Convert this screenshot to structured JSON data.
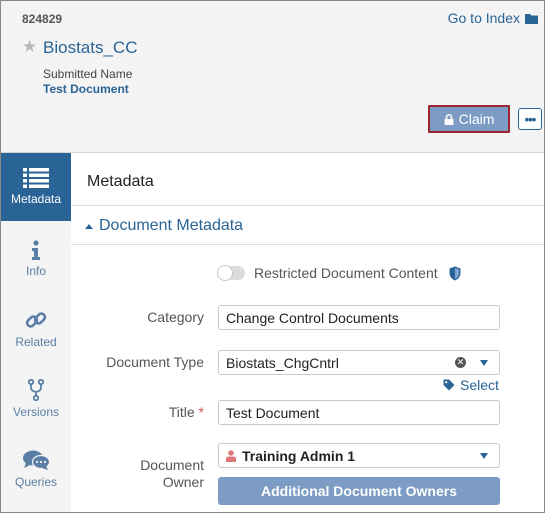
{
  "header": {
    "doc_number": "824829",
    "goto_index_label": "Go to Index",
    "doc_name": "Biostats_CC",
    "submitted_label": "Submitted Name",
    "submitted_value": "Test Document",
    "claim_label": "Claim",
    "more_label": "•••"
  },
  "sidebar": {
    "items": [
      {
        "label": "Metadata",
        "icon": "list-icon",
        "active": true
      },
      {
        "label": "Info",
        "icon": "info-icon",
        "active": false
      },
      {
        "label": "Related",
        "icon": "link-icon",
        "active": false
      },
      {
        "label": "Versions",
        "icon": "branch-icon",
        "active": false
      },
      {
        "label": "Queries",
        "icon": "chat-icon",
        "active": false
      }
    ]
  },
  "main": {
    "title": "Metadata",
    "section_title": "Document Metadata",
    "restricted_label": "Restricted Document Content",
    "restricted_on": false,
    "fields": {
      "category": {
        "label": "Category",
        "value": "Change Control Documents"
      },
      "document_type": {
        "label": "Document Type",
        "value": "Biostats_ChgCntrl"
      },
      "select_label": "Select",
      "title": {
        "label": "Title",
        "required_mark": "*",
        "value": "Test Document"
      },
      "owner": {
        "label_line1": "Document",
        "label_line2": "Owner",
        "value": "Training Admin 1"
      },
      "additional_owners_label": "Additional Document Owners"
    }
  },
  "colors": {
    "accent": "#2a6496",
    "button_bg": "#7c9cc5",
    "claim_border": "#9b2630",
    "required": "#d9534f",
    "user_icon": "#e0777d"
  }
}
